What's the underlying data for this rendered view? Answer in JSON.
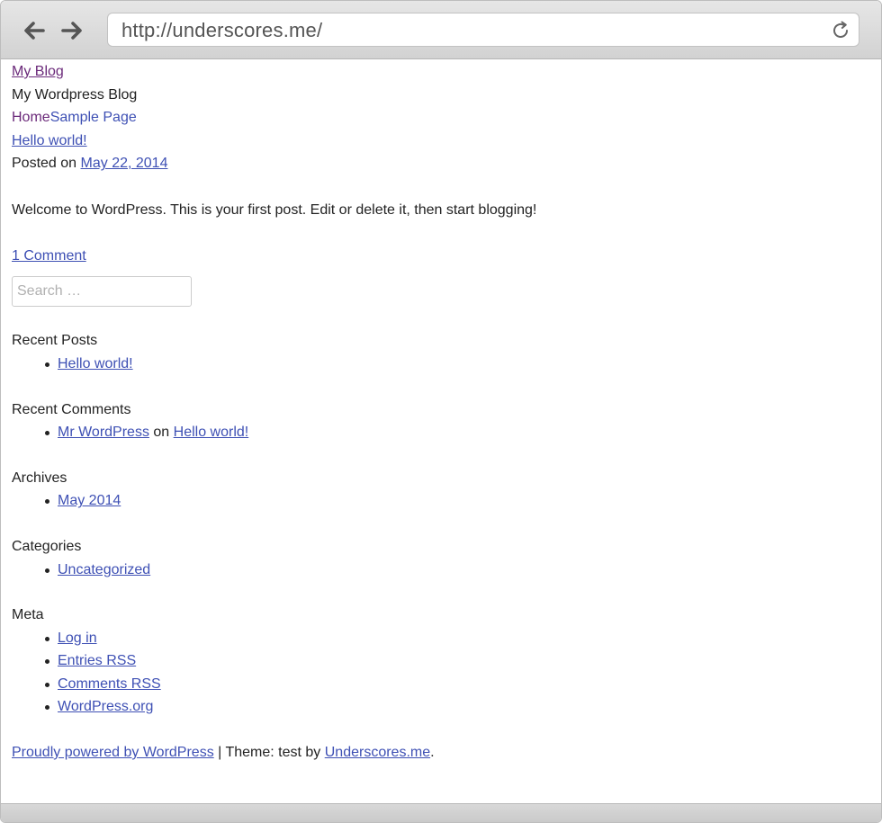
{
  "browser": {
    "url": "http://underscores.me/",
    "back_icon": "back-arrow-icon",
    "forward_icon": "forward-arrow-icon",
    "reload_icon": "reload-icon"
  },
  "site": {
    "title": "My Blog",
    "description": "My Wordpress Blog",
    "menu": [
      "Home",
      "Sample Page"
    ]
  },
  "post": {
    "title": "Hello world!",
    "posted_on_label": "Posted on",
    "date": "May 22, 2014",
    "body": "Welcome to WordPress. This is your first post. Edit or delete it, then start blogging!",
    "comments_link": "1 Comment"
  },
  "search": {
    "placeholder": "Search …"
  },
  "widgets": {
    "recent_posts": {
      "title": "Recent Posts",
      "items": [
        "Hello world!"
      ]
    },
    "recent_comments": {
      "title": "Recent Comments",
      "author": "Mr WordPress",
      "on_label": "on",
      "post": "Hello world!"
    },
    "archives": {
      "title": "Archives",
      "items": [
        "May 2014"
      ]
    },
    "categories": {
      "title": "Categories",
      "items": [
        "Uncategorized"
      ]
    },
    "meta": {
      "title": "Meta",
      "items": [
        "Log in",
        "Entries RSS",
        "Comments RSS",
        "WordPress.org"
      ]
    }
  },
  "footer": {
    "powered_link": "Proudly powered by WordPress",
    "separator": " | Theme: test by ",
    "theme_link": "Underscores.me",
    "end": "."
  },
  "colors": {
    "link": "#3e50b4",
    "visited_link": "#6b2a7a",
    "text": "#222222",
    "toolbar": "#d9d9d9"
  }
}
